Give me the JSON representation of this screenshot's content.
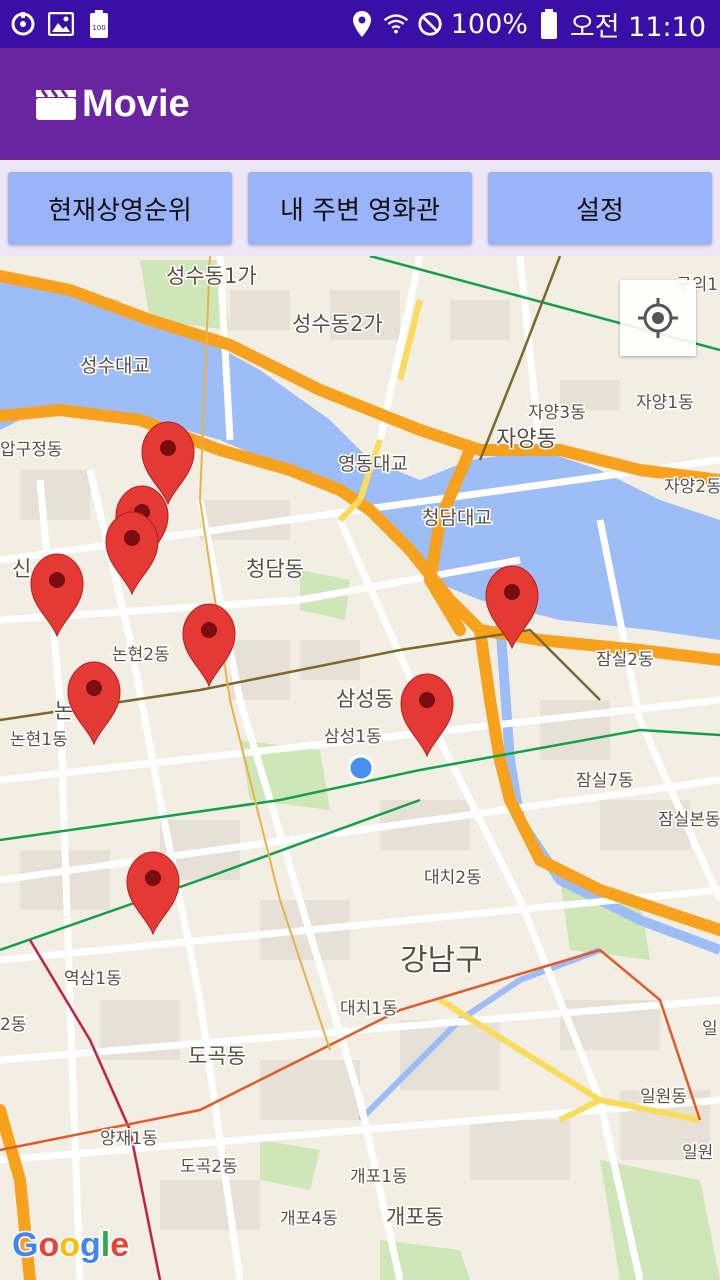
{
  "status_bar": {
    "battery_text": "100%",
    "time": "오전 11:10",
    "left_icons": [
      "sync-icon",
      "image-icon",
      "battery-saver-icon"
    ],
    "right_icons": [
      "location-icon",
      "wifi-icon",
      "no-sound-icon",
      "battery-icon"
    ]
  },
  "app_bar": {
    "title": "Movie",
    "icon": "clapperboard-icon",
    "background": "#6a24a1"
  },
  "buttons": {
    "ranking": "현재상영순위",
    "nearby": "내 주변 영화관",
    "settings": "설정",
    "background": "#9bb3f8"
  },
  "map": {
    "attribution": "Google",
    "my_location_button_icon": "my-location-icon",
    "labels": {
      "l1": "성수동1가",
      "l2": "성수동2가",
      "l3": "성수대교",
      "l4": "자양3동",
      "l5": "자양1동",
      "l6": "자양동",
      "l7": "영동대교",
      "l8": "압구정동",
      "l9": "청담대교",
      "l10": "자양2동",
      "l11": "청담동",
      "l12": "논현2동",
      "l13": "잠실2동",
      "l14": "삼성동",
      "l15": "삼성1동",
      "l16": "논현1동",
      "l17": "잠실7동",
      "l18": "잠실본동",
      "l19": "대치2동",
      "l20": "강남구",
      "l21": "역삼1동",
      "l22": "대치1동",
      "l23": "도곡동",
      "l24": "일원동",
      "l25": "양재1동",
      "l26": "도곡2동",
      "l27": "개포1동",
      "l28": "개포4동",
      "l29": "개포동",
      "l30": "구의1",
      "l31": "신",
      "l32": "논",
      "l33": "2동",
      "l34": "일원",
      "l35": "일"
    },
    "marker_count": 10
  }
}
